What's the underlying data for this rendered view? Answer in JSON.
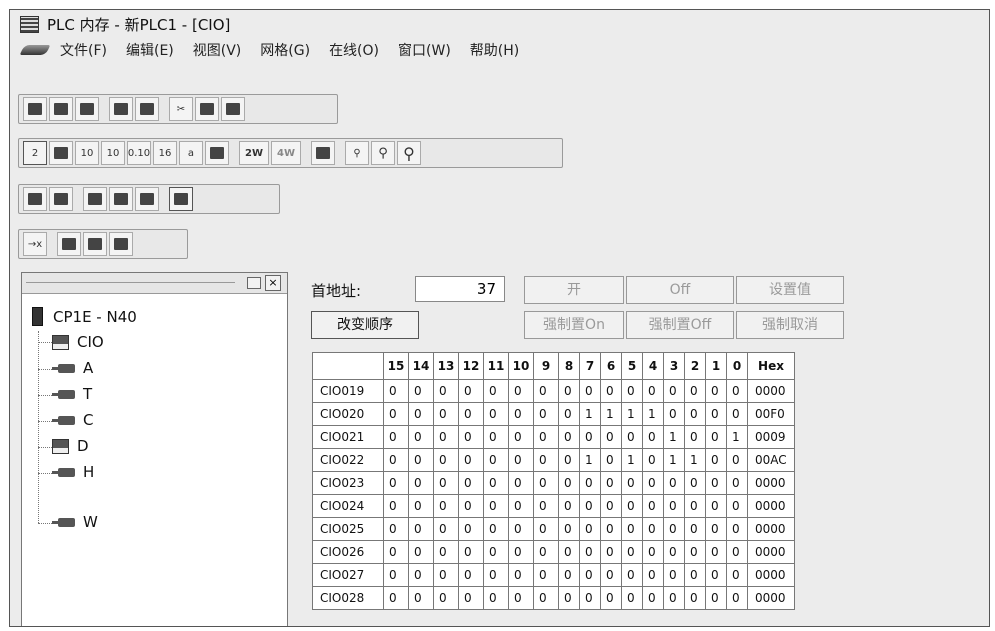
{
  "window": {
    "title": "PLC 内存 - 新PLC1 - [CIO]"
  },
  "menu": [
    "文件(F)",
    "编辑(E)",
    "视图(V)",
    "网格(G)",
    "在线(O)",
    "窗口(W)",
    "帮助(H)"
  ],
  "toolbar2_labels": [
    "2",
    "10",
    "10",
    "0.10",
    "16",
    "a",
    "2W",
    "4W"
  ],
  "tree": {
    "root": "CP1E - N40",
    "items": [
      "CIO",
      "A",
      "T",
      "C",
      "D",
      "H",
      "W"
    ]
  },
  "panel": {
    "address_label": "首地址:",
    "address_value": "37",
    "change_order": "改变顺序",
    "btn_on": "开",
    "btn_off": "Off",
    "btn_set": "设置值",
    "btn_force_on": "强制置On",
    "btn_force_off": "强制置Off",
    "btn_force_cancel": "强制取消"
  },
  "table": {
    "headers": [
      "",
      "15",
      "14",
      "13",
      "12",
      "11",
      "10",
      "9",
      "8",
      "7",
      "6",
      "5",
      "4",
      "3",
      "2",
      "1",
      "0",
      "Hex"
    ],
    "rows": [
      {
        "addr": "CIO019",
        "bits": [
          "0",
          "0",
          "0",
          "0",
          "0",
          "0",
          "0",
          "0",
          "0",
          "0",
          "0",
          "0",
          "0",
          "0",
          "0",
          "0"
        ],
        "hex": "0000"
      },
      {
        "addr": "CIO020",
        "bits": [
          "0",
          "0",
          "0",
          "0",
          "0",
          "0",
          "0",
          "0",
          "1",
          "1",
          "1",
          "1",
          "0",
          "0",
          "0",
          "0"
        ],
        "hex": "00F0"
      },
      {
        "addr": "CIO021",
        "bits": [
          "0",
          "0",
          "0",
          "0",
          "0",
          "0",
          "0",
          "0",
          "0",
          "0",
          "0",
          "0",
          "1",
          "0",
          "0",
          "1"
        ],
        "hex": "0009"
      },
      {
        "addr": "CIO022",
        "bits": [
          "0",
          "0",
          "0",
          "0",
          "0",
          "0",
          "0",
          "0",
          "1",
          "0",
          "1",
          "0",
          "1",
          "1",
          "0",
          "0"
        ],
        "hex": "00AC"
      },
      {
        "addr": "CIO023",
        "bits": [
          "0",
          "0",
          "0",
          "0",
          "0",
          "0",
          "0",
          "0",
          "0",
          "0",
          "0",
          "0",
          "0",
          "0",
          "0",
          "0"
        ],
        "hex": "0000"
      },
      {
        "addr": "CIO024",
        "bits": [
          "0",
          "0",
          "0",
          "0",
          "0",
          "0",
          "0",
          "0",
          "0",
          "0",
          "0",
          "0",
          "0",
          "0",
          "0",
          "0"
        ],
        "hex": "0000"
      },
      {
        "addr": "CIO025",
        "bits": [
          "0",
          "0",
          "0",
          "0",
          "0",
          "0",
          "0",
          "0",
          "0",
          "0",
          "0",
          "0",
          "0",
          "0",
          "0",
          "0"
        ],
        "hex": "0000"
      },
      {
        "addr": "CIO026",
        "bits": [
          "0",
          "0",
          "0",
          "0",
          "0",
          "0",
          "0",
          "0",
          "0",
          "0",
          "0",
          "0",
          "0",
          "0",
          "0",
          "0"
        ],
        "hex": "0000"
      },
      {
        "addr": "CIO027",
        "bits": [
          "0",
          "0",
          "0",
          "0",
          "0",
          "0",
          "0",
          "0",
          "0",
          "0",
          "0",
          "0",
          "0",
          "0",
          "0",
          "0"
        ],
        "hex": "0000"
      },
      {
        "addr": "CIO028",
        "bits": [
          "0",
          "0",
          "0",
          "0",
          "0",
          "0",
          "0",
          "0",
          "0",
          "0",
          "0",
          "0",
          "0",
          "0",
          "0",
          "0"
        ],
        "hex": "0000"
      }
    ]
  }
}
